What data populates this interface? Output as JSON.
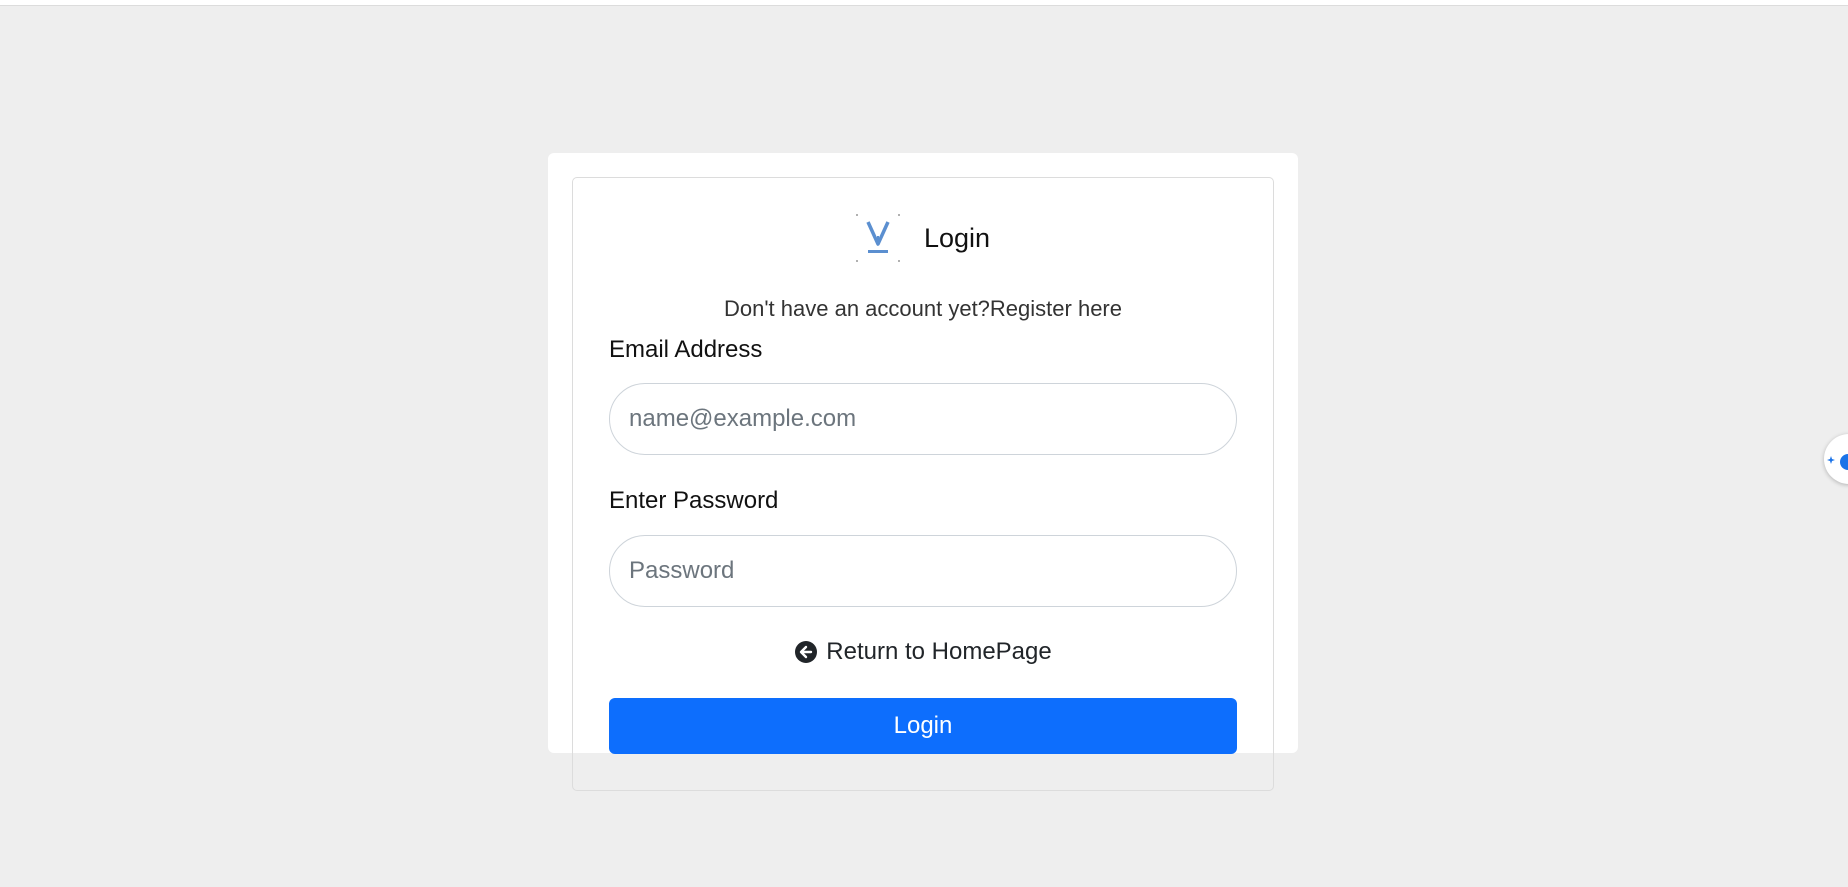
{
  "header": {
    "title": "Login",
    "logo_icon": "v-logo-icon"
  },
  "register": {
    "prompt": "Don't have an account yet?",
    "link_label": "Register here"
  },
  "form": {
    "email_label": "Email Address",
    "email_placeholder": "name@example.com",
    "email_value": "",
    "password_label": "Enter Password",
    "password_placeholder": "Password",
    "password_value": ""
  },
  "return_link": {
    "label": "Return to HomePage",
    "icon": "arrow-left-circle-icon"
  },
  "login_button": {
    "label": "Login"
  },
  "side_widget": {
    "icon": "assistant-sparkle-icon"
  },
  "colors": {
    "background": "#eeeeee",
    "panel": "#ffffff",
    "primary": "#0d6efd",
    "logo": "#5b8fd0"
  }
}
